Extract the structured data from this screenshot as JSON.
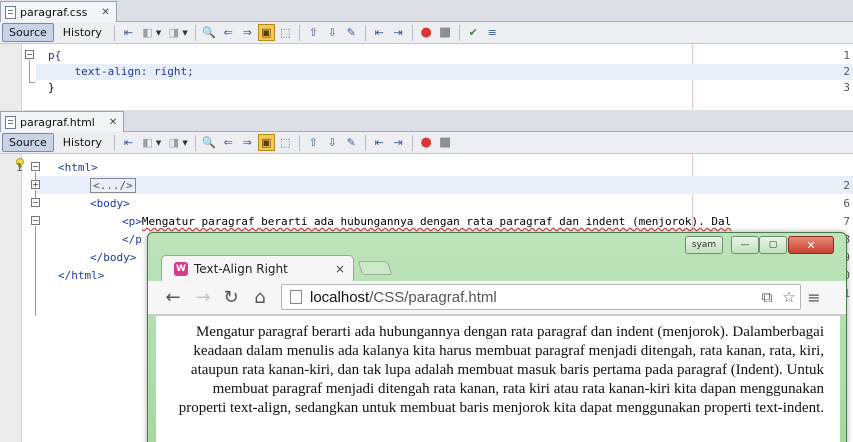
{
  "css_file": {
    "tab_name": "paragraf.css",
    "source_label": "Source",
    "history_label": "History",
    "lines": [
      {
        "num": "1",
        "text": "p{"
      },
      {
        "num": "2",
        "text": "    text-align: right;"
      },
      {
        "num": "3",
        "text": "}"
      }
    ]
  },
  "html_file": {
    "tab_name": "paragraf.html",
    "source_label": "Source",
    "history_label": "History",
    "line_numbers": [
      "1",
      "2",
      "6",
      "7",
      "8",
      "9",
      "10",
      "11"
    ],
    "code": {
      "l1": "<html>",
      "l2_folded": "<.../>",
      "l6": "<body>",
      "l7_tag": "<p>",
      "l7_text": "Mengatur paragraf berarti ada hubungannya dengan rata paragraf dan indent (menjorok). Dal",
      "l8": "</p",
      "l9": "</body>",
      "l10": "</html>"
    }
  },
  "browser": {
    "tab_title": "Text-Align Right",
    "tab_close": "×",
    "profile_label": "syam",
    "window_controls": {
      "minimize": "—",
      "maximize": "▢",
      "close": "✕"
    },
    "url_host": "localhost",
    "url_path": "/CSS/paragraf.html",
    "paragraph": "Mengatur paragraf berarti ada hubungannya dengan rata paragraf dan indent (menjorok). Dalamberbagai keadaan dalam menulis ada kalanya kita harus membuat paragraf menjadi ditengah, rata kanan, rata, kiri, ataupun rata kanan-kiri, dan tak lupa adalah membuat masuk baris pertama pada paragraf (Indent). Untuk membuat paragraf menjadi ditengah rata kanan, rata kiri atau rata kanan-kiri kita dapan menggunakan properti text-align, sedangkan untuk membuat baris menjorok kita dapat menggunakan properti text-indent."
  }
}
